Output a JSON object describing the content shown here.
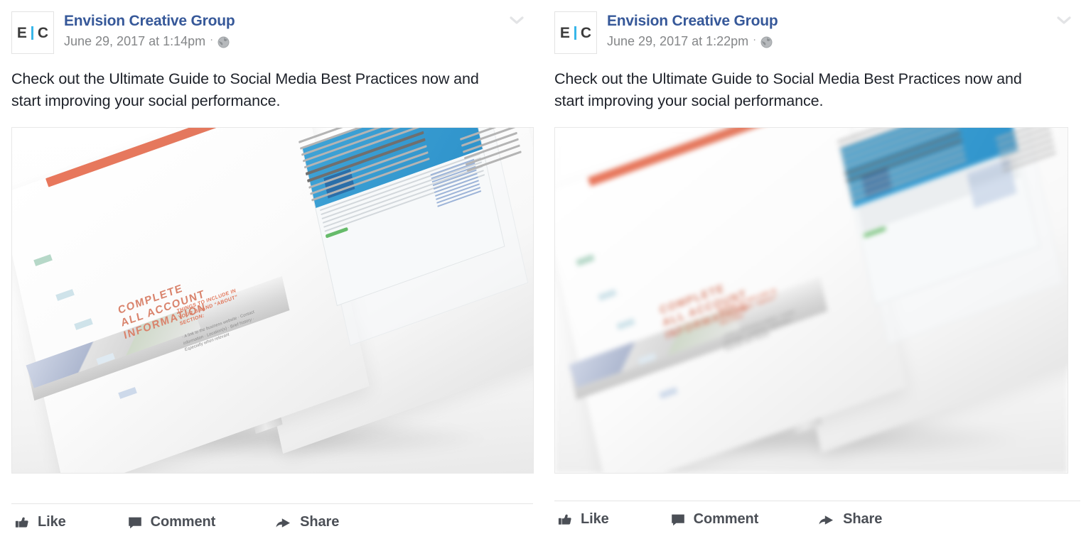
{
  "posts": [
    {
      "avatar": {
        "letter_left": "E",
        "letter_right": "C",
        "bar_color": "#37b6e9"
      },
      "page_name": "Envision Creative Group",
      "timestamp": "June 29, 2017 at 1:14pm",
      "separator": "·",
      "privacy_icon": "globe-icon",
      "menu_icon": "chevron-down-icon",
      "message": "Check out the Ultimate Guide to Social Media Best Practices now and start improving your social performance.",
      "photo": {
        "alt": "open-book-spread-photo",
        "render": "sharp",
        "stamp_text": "COMPLETE\nALL ACCOUNT\nINFORMATION",
        "heading": "THINGS TO INCLUDE IN YOUR BRAND “ABOUT” SECTION:",
        "bullets": "· A link to the business website\n· Contact information\n· Location(s)\n· Brief history\n· Especially when relevant",
        "accent_color": "#e0765a"
      },
      "actions": [
        {
          "label": "Like",
          "icon": "thumbs-up-icon"
        },
        {
          "label": "Comment",
          "icon": "speech-bubble-icon"
        },
        {
          "label": "Share",
          "icon": "share-arrow-icon"
        }
      ]
    },
    {
      "avatar": {
        "letter_left": "E",
        "letter_right": "C",
        "bar_color": "#37b6e9"
      },
      "page_name": "Envision Creative Group",
      "timestamp": "June 29, 2017 at 1:22pm",
      "separator": "·",
      "privacy_icon": "globe-icon",
      "menu_icon": "chevron-down-icon",
      "message": "Check out the Ultimate Guide to Social Media Best Practices now and start improving your social performance.",
      "photo": {
        "alt": "open-book-spread-photo-blurred",
        "render": "blurry",
        "stamp_text": "COMPLETE\nALL ACCOUNT\nINFORMATION",
        "heading": "THINGS TO INCLUDE IN YOUR BRAND “ABOUT” SECTION:",
        "bullets": "· A link to the business website\n· Contact information\n· Location(s)\n· Brief history\n· Especially when relevant",
        "accent_color": "#e0765a"
      },
      "actions": [
        {
          "label": "Like",
          "icon": "thumbs-up-icon"
        },
        {
          "label": "Comment",
          "icon": "speech-bubble-icon"
        },
        {
          "label": "Share",
          "icon": "share-arrow-icon"
        }
      ]
    }
  ],
  "colors": {
    "page_name_link": "#365899",
    "body_text": "#1d2129",
    "meta_text": "#848688",
    "action_text": "#4b4f56",
    "divider": "#e5e5e5"
  }
}
